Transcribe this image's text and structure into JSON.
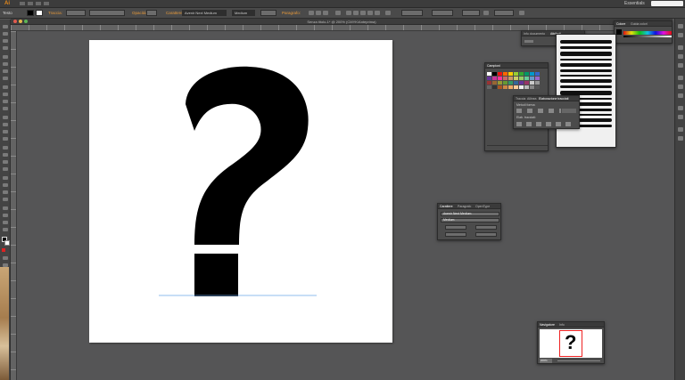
{
  "app": {
    "logo": "Ai",
    "workspace": "Essentials"
  },
  "control_bar": {
    "label_testo": "Testo",
    "label_traccia": "Traccia:",
    "label_opacita": "Opacità:",
    "label_carattere": "Carattere:",
    "font_name": "Avenir Next Medium",
    "font_style": "Medium",
    "label_paragrafo": "Paragrafo:"
  },
  "document": {
    "title": "Senza titolo-1* @ 200% (CMYK/Anteprima)"
  },
  "artwork": {
    "glyph_char": "?"
  },
  "panels": {
    "info_attributi": {
      "tab1": "Info documento",
      "tab2": "Attributi"
    },
    "campioni": {
      "tab": "Campioni"
    },
    "tracciati": {
      "tab1": "Traccia",
      "tab2": "Allinea",
      "tab3": "Elaborazione tracciati",
      "row1": "Metodi forma:",
      "row2": "Elab. tracciati:"
    },
    "colore": {
      "tab1": "Colore",
      "tab2": "Guida colori"
    },
    "carattere": {
      "tab1": "Carattere",
      "tab2": "Paragrafo",
      "tab3": "OpenType",
      "font": "Avenir Next Medium",
      "style": "Medium"
    },
    "navigatore": {
      "tab1": "Navigatore",
      "tab2": "Info",
      "zoom": "200%"
    }
  },
  "colors": {
    "accent": "#e89a3a",
    "canvas": "#555556",
    "panel": "#4b4b4b",
    "artboard": "#ffffff"
  }
}
